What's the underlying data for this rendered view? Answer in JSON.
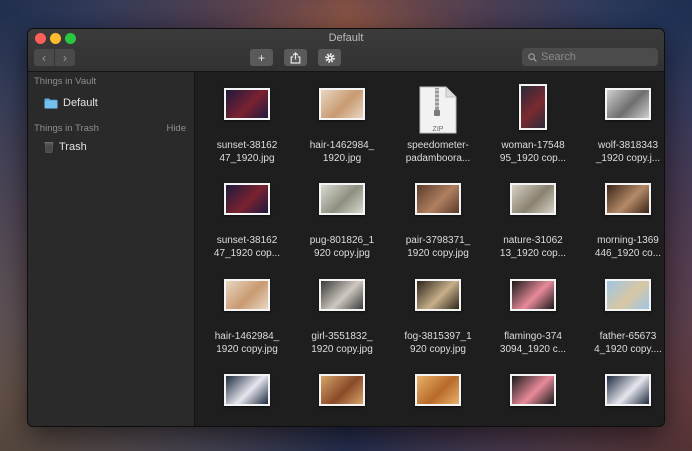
{
  "window": {
    "title": "Default"
  },
  "toolbar": {
    "back_glyph": "‹",
    "forward_glyph": "›",
    "add_glyph": "+",
    "share_icon": "share-icon",
    "settings_icon": "gear-icon",
    "search_placeholder": "Search"
  },
  "sidebar": {
    "vault_header": "Things in Vault",
    "vault_items": [
      {
        "label": "Default",
        "icon": "folder-icon"
      }
    ],
    "trash_header": "Things in Trash",
    "trash_action": "Hide",
    "trash_items": [
      {
        "label": "Trash",
        "icon": "trash-icon"
      }
    ]
  },
  "files": [
    {
      "line1": "sunset-38162",
      "line2": "47_1920.jpg",
      "kind": "landscape",
      "colors": [
        "#1e1a3e",
        "#7a2230"
      ]
    },
    {
      "line1": "hair-1462984_",
      "line2": "1920.jpg",
      "kind": "landscape",
      "colors": [
        "#e9d6c3",
        "#c89a70"
      ]
    },
    {
      "line1": "speedometer-",
      "line2": "padamboora...",
      "kind": "zip",
      "badge": "ZIP"
    },
    {
      "line1": "woman-17548",
      "line2": "95_1920 cop...",
      "kind": "portrait",
      "colors": [
        "#2b2b3a",
        "#7a2a30"
      ]
    },
    {
      "line1": "wolf-3818343",
      "line2": "_1920 copy.j...",
      "kind": "landscape",
      "colors": [
        "#cfcfcf",
        "#6e6e6e"
      ]
    },
    {
      "line1": "sunset-38162",
      "line2": "47_1920 cop...",
      "kind": "landscape",
      "colors": [
        "#1e1a3e",
        "#7a2230"
      ]
    },
    {
      "line1": "pug-801826_1",
      "line2": "920 copy.jpg",
      "kind": "landscape",
      "colors": [
        "#d9dbd2",
        "#8f8f80"
      ]
    },
    {
      "line1": "pair-3798371_",
      "line2": "1920 copy.jpg",
      "kind": "landscape",
      "colors": [
        "#5a3a2a",
        "#b08060"
      ]
    },
    {
      "line1": "nature-31062",
      "line2": "13_1920 cop...",
      "kind": "landscape",
      "colors": [
        "#d7d2c6",
        "#8a8270"
      ]
    },
    {
      "line1": "morning-1369",
      "line2": "446_1920 co...",
      "kind": "landscape",
      "colors": [
        "#3a2418",
        "#b58a68"
      ]
    },
    {
      "line1": "hair-1462984_",
      "line2": "1920 copy.jpg",
      "kind": "landscape",
      "colors": [
        "#e9d6c3",
        "#c89a70"
      ]
    },
    {
      "line1": "girl-3551832_",
      "line2": "1920 copy.jpg",
      "kind": "landscape",
      "colors": [
        "#3a3a3a",
        "#cfc9c0"
      ]
    },
    {
      "line1": "fog-3815397_1",
      "line2": "920 copy.jpg",
      "kind": "landscape",
      "colors": [
        "#2c2418",
        "#c7b08a"
      ]
    },
    {
      "line1": "flamingo-374",
      "line2": "3094_1920 c...",
      "kind": "landscape",
      "colors": [
        "#1a1a1a",
        "#e88a9a"
      ]
    },
    {
      "line1": "father-65673",
      "line2": "4_1920 copy....",
      "kind": "landscape",
      "colors": [
        "#9ec6e6",
        "#d8c7a2"
      ]
    },
    {
      "line1": "",
      "line2": "",
      "kind": "landscape",
      "colors": [
        "#1d2a3e",
        "#e6e6ee"
      ]
    },
    {
      "line1": "",
      "line2": "",
      "kind": "landscape",
      "colors": [
        "#d6a56a",
        "#8a4a28"
      ]
    },
    {
      "line1": "",
      "line2": "",
      "kind": "landscape",
      "colors": [
        "#e8b26a",
        "#b86a2a"
      ]
    },
    {
      "line1": "",
      "line2": "",
      "kind": "landscape",
      "colors": [
        "#1a1a1a",
        "#e88a9a"
      ]
    },
    {
      "line1": "",
      "line2": "",
      "kind": "landscape",
      "colors": [
        "#1d2a3e",
        "#e6e6ee"
      ]
    }
  ],
  "colors": {
    "accent_folder": "#5fb0e8",
    "window_bg": "#1e1e1e",
    "sidebar_bg": "#2a2a2a"
  }
}
